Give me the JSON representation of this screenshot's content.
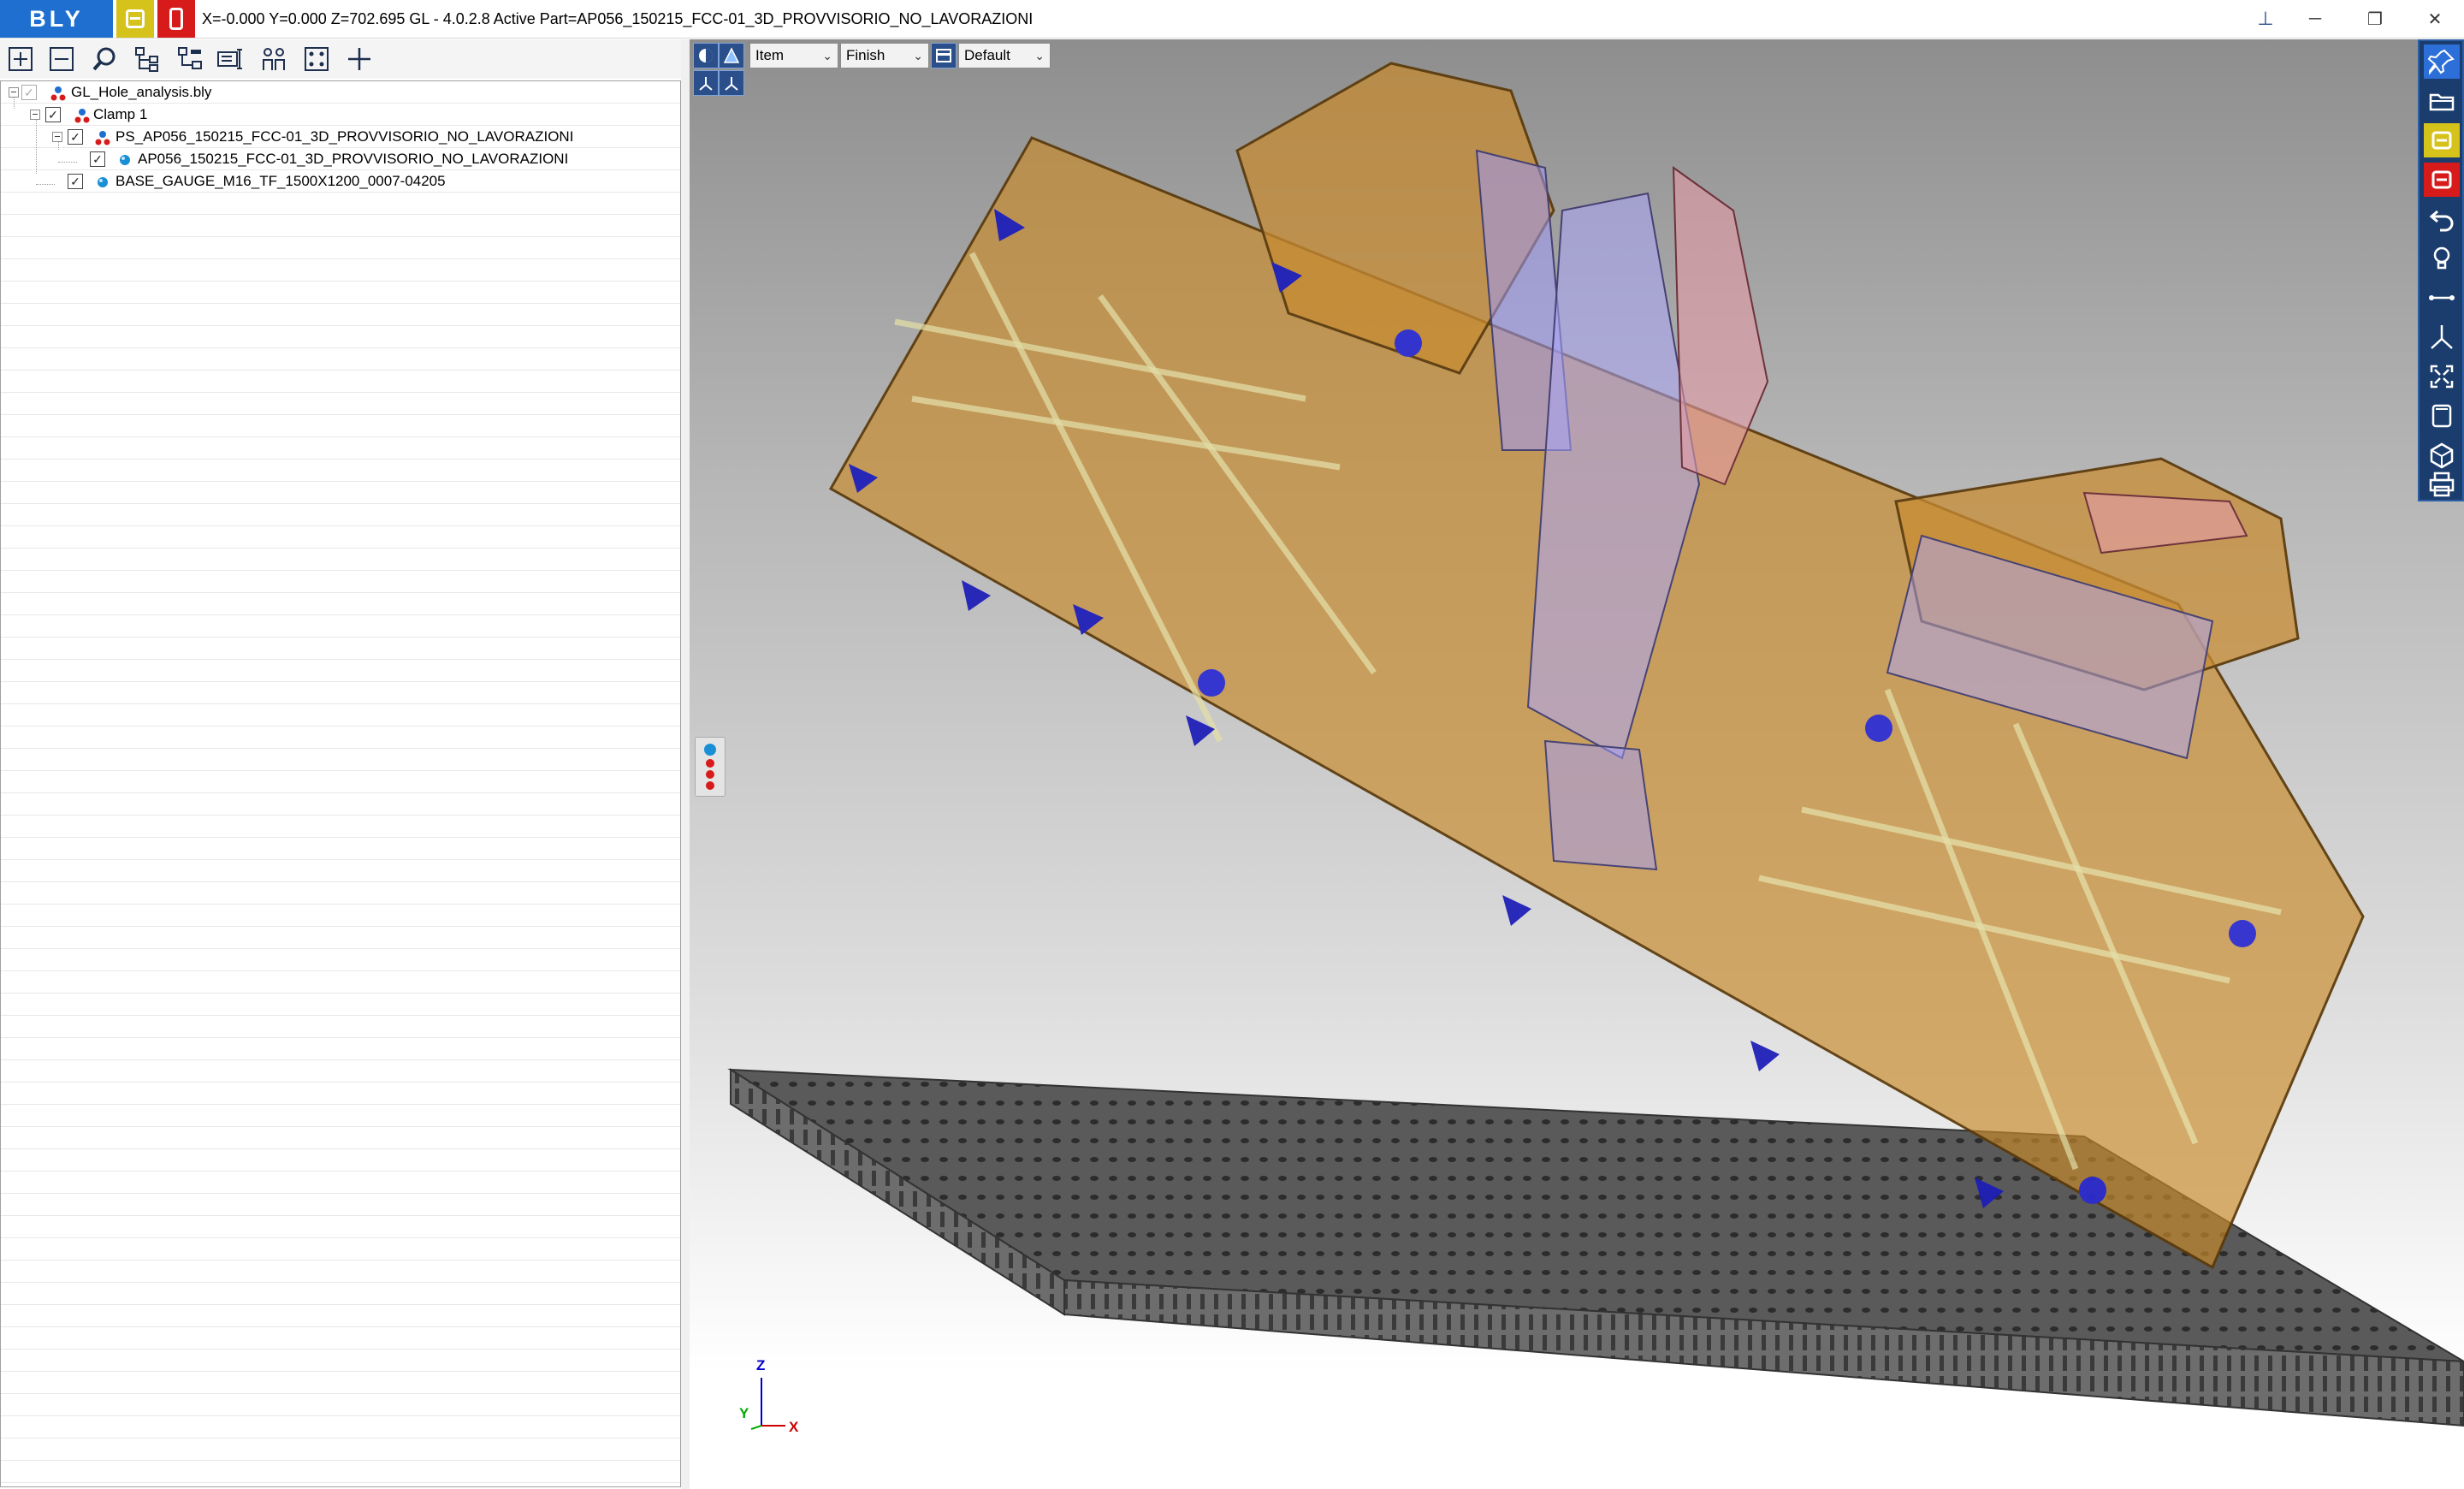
{
  "app": {
    "logo": "BLY",
    "title": "X=-0.000 Y=0.000 Z=702.695   GL - 4.0.2.8 Active Part=AP056_150215_FCC-01_3D_PROVVISORIO_NO_LAVORAZIONI",
    "brand_color": "#1f6fd1",
    "accent_yellow": "#d5c21a",
    "accent_red": "#d71b1b"
  },
  "window_controls": {
    "minimize": "─",
    "maximize": "❐",
    "close": "✕"
  },
  "left_toolbar": {
    "icons": [
      "expand-all-icon",
      "collapse-all-icon",
      "search-icon",
      "tree-hierarchy-icon",
      "tree-branch-icon",
      "tree-properties-icon",
      "users-icon",
      "selection-box-icon",
      "add-icon"
    ]
  },
  "tree": {
    "items": [
      {
        "label": "GL_Hole_analysis.bly",
        "level": 0,
        "checked": true,
        "icon": "assembly-icon"
      },
      {
        "label": "Clamp 1",
        "level": 1,
        "checked": true,
        "icon": "assembly-icon"
      },
      {
        "label": "PS_AP056_150215_FCC-01_3D_PROVVISORIO_NO_LAVORAZIONI",
        "level": 2,
        "checked": true,
        "icon": "assembly-icon"
      },
      {
        "label": "AP056_150215_FCC-01_3D_PROVVISORIO_NO_LAVORAZIONI",
        "level": 3,
        "checked": true,
        "icon": "part-icon"
      },
      {
        "label": "BASE_GAUGE_M16_TF_1500X1200_0007-04205",
        "level": 2,
        "checked": true,
        "icon": "part-icon"
      }
    ]
  },
  "viewport_toolbar": {
    "selection_mode": "Item",
    "render_mode": "Finish",
    "view_style": "Default"
  },
  "right_toolbar": {
    "icons": [
      "pin-icon",
      "folder-icon",
      "yellow-panel-icon",
      "red-panel-icon",
      "undo-icon",
      "lightbulb-icon",
      "measure-icon",
      "axis-icon",
      "fit-view-icon",
      "frame-icon",
      "cube-icon",
      "print-icon"
    ]
  },
  "axes": {
    "z": "Z",
    "y": "Y",
    "x": "X"
  }
}
